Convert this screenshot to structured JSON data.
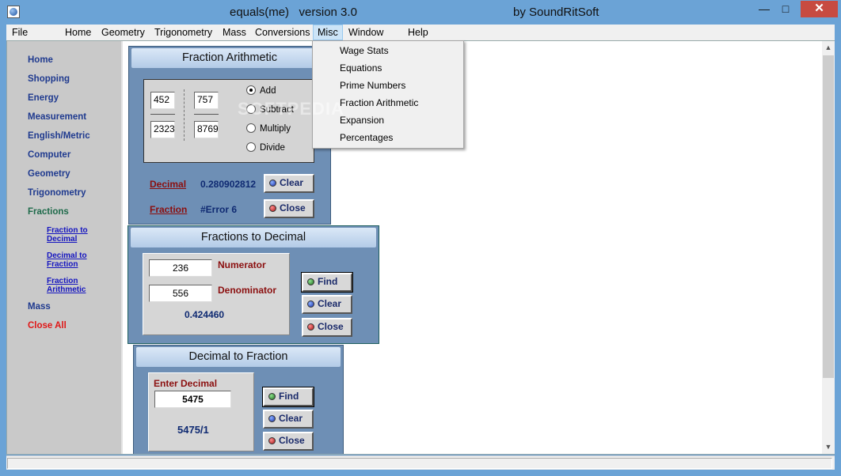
{
  "window": {
    "title": "equals(me)   version 3.0",
    "by": "by SoundRitSoft",
    "buttons": {
      "minimize": "—",
      "maximize": "□",
      "close": "✕"
    }
  },
  "menu": [
    {
      "label": "File"
    },
    {
      "label": "Home"
    },
    {
      "label": "Geometry"
    },
    {
      "label": "Trigonometry"
    },
    {
      "label": "Mass"
    },
    {
      "label": "Conversions"
    },
    {
      "label": "Misc"
    },
    {
      "label": "Window"
    },
    {
      "label": "Help"
    }
  ],
  "misc_dropdown": [
    "Wage Stats",
    "Equations",
    "Prime Numbers",
    "Fraction Arithmetic",
    "Expansion",
    "Percentages"
  ],
  "sidebar": {
    "items": [
      "Home",
      "Shopping",
      "Energy",
      "Measurement",
      "English/Metric",
      "Computer",
      "Geometry",
      "Trigonometry",
      "Fractions"
    ],
    "sub_items": [
      "Fraction to Decimal",
      "Decimal to Fraction",
      "Fraction Arithmetic"
    ],
    "bottom": [
      "Mass",
      "Close All"
    ]
  },
  "fraction_arithmetic": {
    "title": "Fraction Arithmetic",
    "num1": "452",
    "den1": "2323",
    "num2": "757",
    "den2": "8769",
    "operations": [
      "Add",
      "Subtract",
      "Multiply",
      "Divide"
    ],
    "selected": "Add",
    "decimal_label": "Decimal",
    "decimal_value": "0.280902812",
    "fraction_label": "Fraction",
    "fraction_value": "#Error 6",
    "clear": "Clear",
    "close": "Close"
  },
  "fractions_to_decimal": {
    "title": "Fractions to Decimal",
    "numerator": "236",
    "numerator_label": "Numerator",
    "denominator": "556",
    "denominator_label": "Denominator",
    "result": "0.424460",
    "find": "Find",
    "clear": "Clear",
    "close": "Close"
  },
  "decimal_to_fraction": {
    "title": "Decimal to Fraction",
    "enter_label": "Enter Decimal",
    "input": "5475",
    "result": "5475/1",
    "find": "Find",
    "clear": "Clear",
    "close": "Close"
  },
  "watermark": "SOFTPEDIA",
  "colors": {
    "window_frame": "#6ba3d6",
    "child_window": "#6e8fb5",
    "nav_link": "#1f3a8f",
    "close_all": "#e01717",
    "label_red": "#8b0f0f",
    "value_blue": "#0f2a72"
  }
}
